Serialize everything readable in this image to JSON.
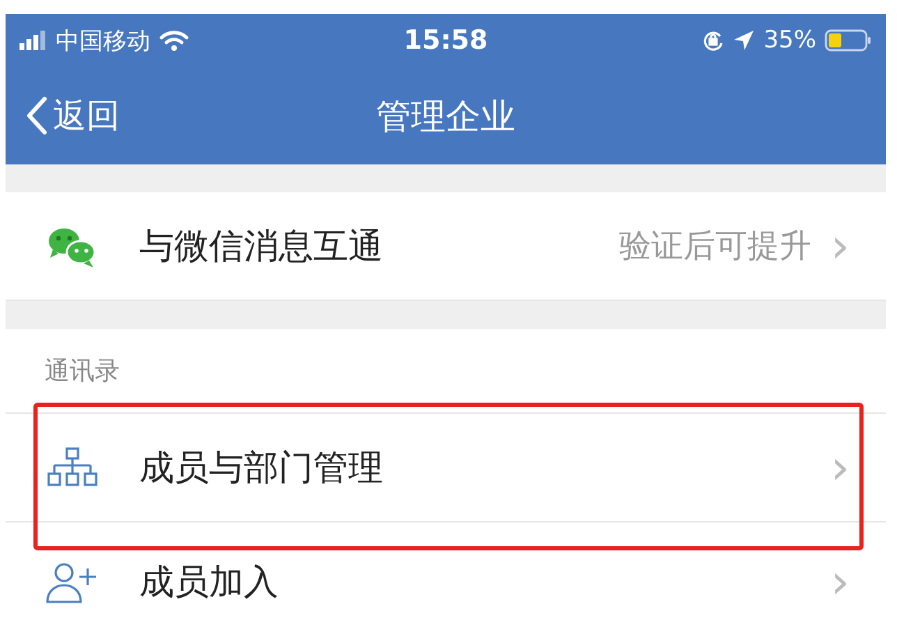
{
  "status_bar": {
    "carrier": "中国移动",
    "time": "15:58",
    "battery": "35%"
  },
  "nav": {
    "back": "返回",
    "title": "管理企业"
  },
  "groups": [
    {
      "rows": [
        {
          "kind": "wechat",
          "label": "与微信消息互通",
          "detail": "验证后可提升",
          "chevron": "›",
          "highlighted": false
        }
      ]
    },
    {
      "header": "通讯录",
      "rows": [
        {
          "kind": "org",
          "label": "成员与部门管理",
          "chevron": "›",
          "highlighted": true
        },
        {
          "kind": "add-member",
          "label": "成员加入",
          "chevron": "›",
          "highlighted": false
        }
      ]
    }
  ]
}
